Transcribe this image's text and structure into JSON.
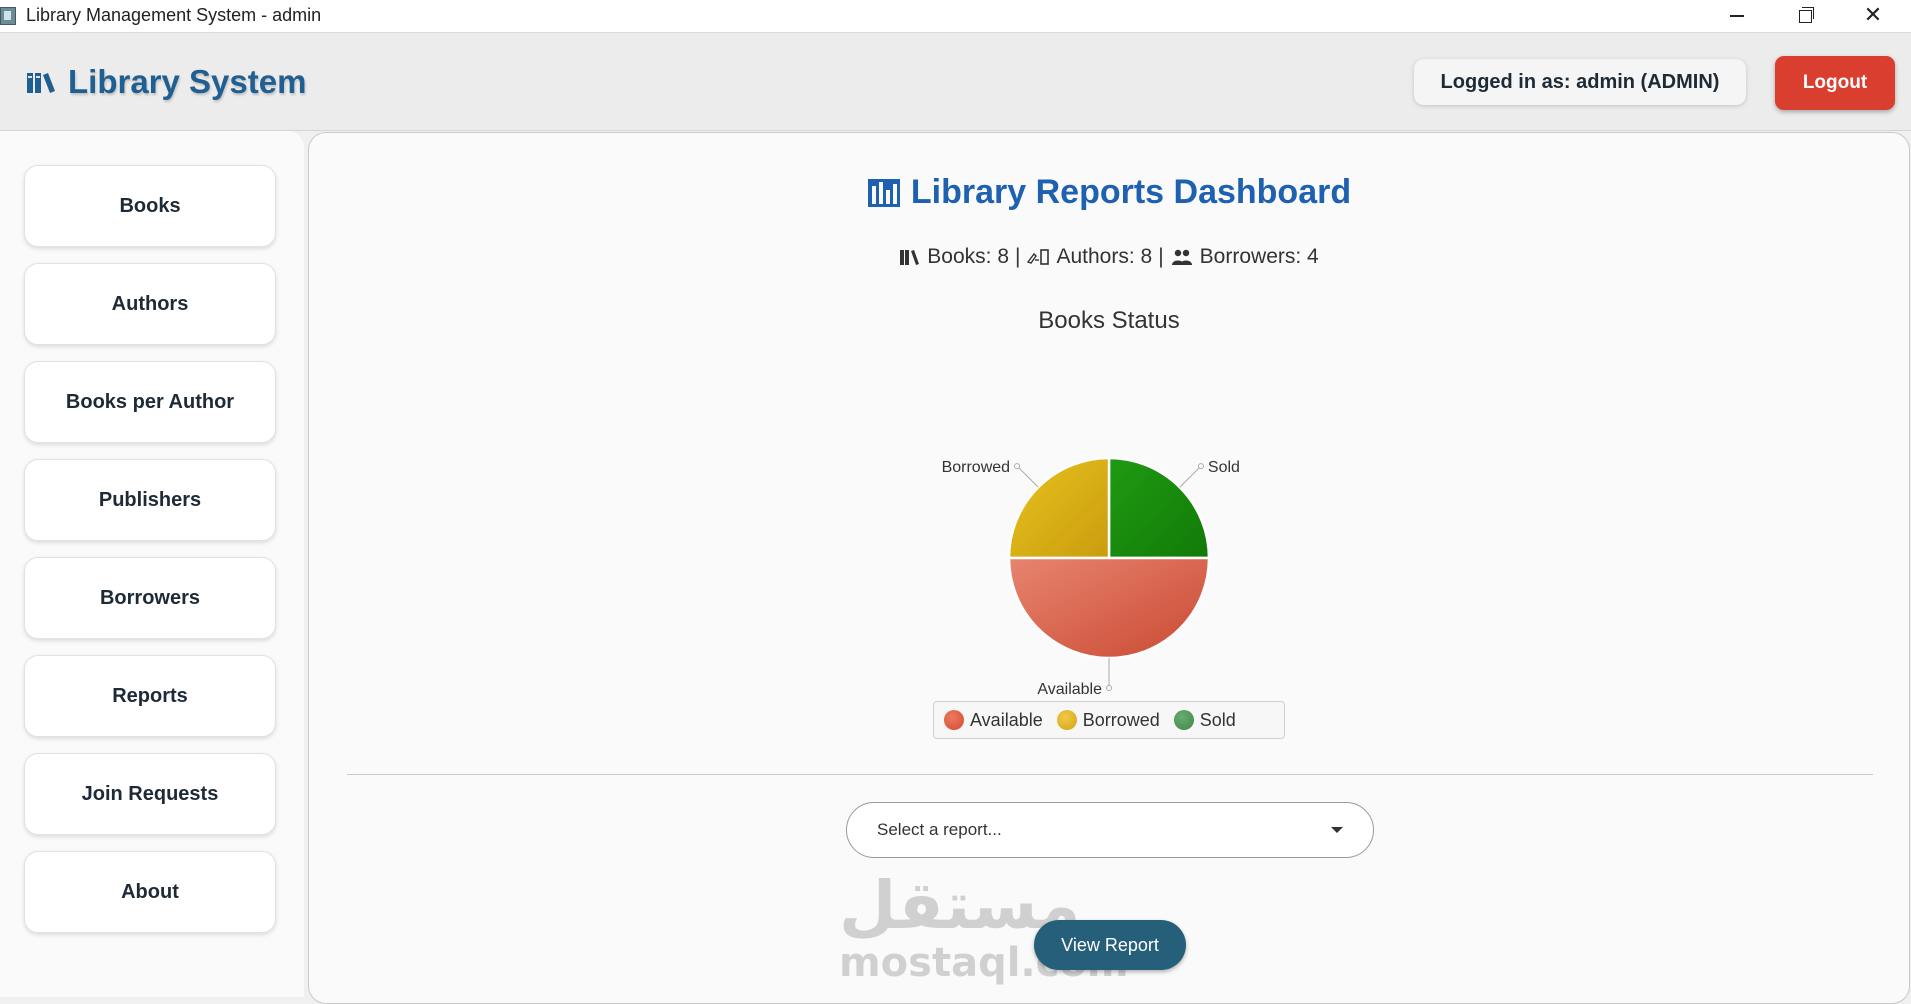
{
  "window": {
    "title": "Library Management System - admin"
  },
  "header": {
    "brand": "Library System",
    "logged_in": "Logged in as: admin (ADMIN)",
    "logout_label": "Logout"
  },
  "sidebar": {
    "items": [
      {
        "label": "Books"
      },
      {
        "label": "Authors"
      },
      {
        "label": "Books per Author"
      },
      {
        "label": "Publishers"
      },
      {
        "label": "Borrowers"
      },
      {
        "label": "Reports"
      },
      {
        "label": "Join Requests"
      },
      {
        "label": "About"
      }
    ]
  },
  "main": {
    "title": "Library Reports Dashboard",
    "stats": {
      "books": "Books: 8",
      "authors": "Authors: 8",
      "borrowers": "Borrowers: 4",
      "separator": "|"
    },
    "report_select": {
      "value": "Select a report..."
    },
    "view_report_label": "View Report",
    "watermark": {
      "arabic": "مستقل",
      "latin": "mostaql.com"
    }
  },
  "colors": {
    "brand": "#1f5f91",
    "title": "#1e61b0",
    "logout": "#d93e2e",
    "view_button": "#255f7a",
    "available": "#d9614a",
    "borrowed": "#d9ae14",
    "sold": "#178a0c"
  },
  "chart_data": {
    "type": "pie",
    "title": "Books Status",
    "categories": [
      "Available",
      "Borrowed",
      "Sold"
    ],
    "values": [
      4,
      2,
      2
    ],
    "colors": [
      "#d9614a",
      "#d9ae14",
      "#178a0c"
    ],
    "legend": "bottom"
  }
}
